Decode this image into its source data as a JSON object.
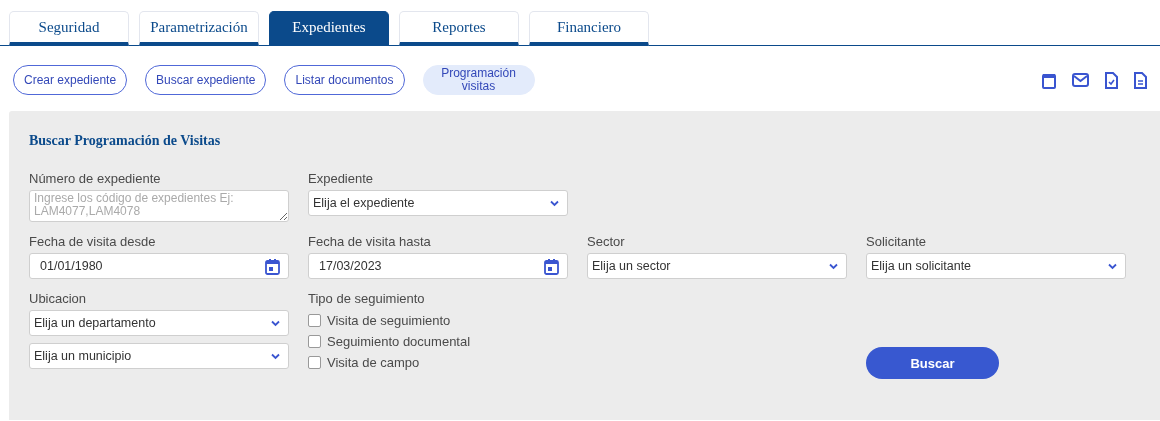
{
  "tabs": [
    {
      "label": "Seguridad",
      "selected": false
    },
    {
      "label": "Parametrización",
      "selected": false
    },
    {
      "label": "Expedientes",
      "selected": true
    },
    {
      "label": "Reportes",
      "selected": false
    },
    {
      "label": "Financiero",
      "selected": false
    }
  ],
  "subnav": [
    {
      "label": "Crear expediente",
      "selected": false
    },
    {
      "label": "Buscar expediente",
      "selected": false
    },
    {
      "label": "Listar documentos",
      "selected": false
    },
    {
      "label": "Programación visitas",
      "selected": true
    }
  ],
  "panel": {
    "title": "Buscar Programación de Visitas",
    "rows": [
      [
        {
          "kind": "textarea",
          "label": "Número de expediente",
          "placeholder": "Ingrese los código de expedientes Ej: LAM4077,LAM4078"
        },
        {
          "kind": "select",
          "label": "Expediente",
          "value": "Elija el expediente"
        }
      ],
      [
        {
          "kind": "date",
          "label": "Fecha de visita desde",
          "value": "01/01/1980"
        },
        {
          "kind": "date",
          "label": "Fecha de visita hasta",
          "value": "17/03/2023"
        },
        {
          "kind": "select",
          "label": "Sector",
          "value": "Elija un sector"
        },
        {
          "kind": "select",
          "label": "Solicitante",
          "value": "Elija un solicitante"
        }
      ],
      [
        {
          "kind": "selects",
          "label": "Ubicacion",
          "values": [
            "Elija un departamento",
            "Elija un municipio"
          ]
        },
        {
          "kind": "checkboxes",
          "label": "Tipo de seguimiento",
          "options": [
            {
              "label": "Visita de seguimiento",
              "checked": false
            },
            {
              "label": "Seguimiento documental",
              "checked": false
            },
            {
              "label": "Visita de campo",
              "checked": false
            }
          ]
        }
      ]
    ],
    "search_button": "Buscar"
  }
}
